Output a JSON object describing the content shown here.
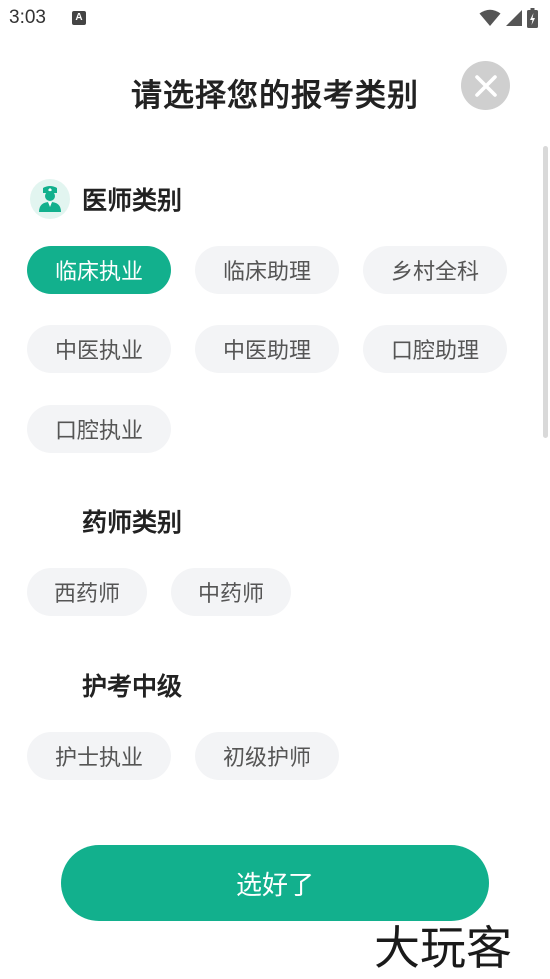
{
  "status_bar": {
    "time": "3:03",
    "notification_icon": "a-notification-icon",
    "icons": [
      "wifi-icon",
      "signal-icon",
      "battery-charging-icon"
    ]
  },
  "header": {
    "title": "请选择您的报考类别",
    "close_icon": "close-icon"
  },
  "sections": [
    {
      "title": "医师类别",
      "icon": "doctor-avatar-icon",
      "chips": [
        {
          "label": "临床执业",
          "selected": true
        },
        {
          "label": "临床助理",
          "selected": false
        },
        {
          "label": "乡村全科",
          "selected": false
        },
        {
          "label": "中医执业",
          "selected": false
        },
        {
          "label": "中医助理",
          "selected": false
        },
        {
          "label": "口腔助理",
          "selected": false
        },
        {
          "label": "口腔执业",
          "selected": false
        }
      ]
    },
    {
      "title": "药师类别",
      "chips": [
        {
          "label": "西药师",
          "selected": false
        },
        {
          "label": "中药师",
          "selected": false
        }
      ]
    },
    {
      "title": "护考中级",
      "chips": [
        {
          "label": "护士执业",
          "selected": false
        },
        {
          "label": "初级护师",
          "selected": false
        }
      ]
    }
  ],
  "confirm_button": {
    "label": "选好了"
  },
  "watermark": "大玩客",
  "colors": {
    "accent": "#12b08d",
    "chip_background": "#f3f4f6",
    "chip_text": "#555555",
    "close_background": "#cfcfcf"
  }
}
